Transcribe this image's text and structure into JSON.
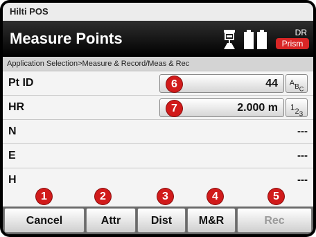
{
  "app": {
    "title": "Hilti POS"
  },
  "header": {
    "title": "Measure Points",
    "status_top": "DR",
    "status_badge": "Prism",
    "badge_color": "#d92626"
  },
  "breadcrumb": "Application Selection>Measure & Record/Meas & Rec",
  "fields": [
    {
      "label": "Pt ID",
      "value": "44",
      "mode_icon": "alpha-abc-icon"
    },
    {
      "label": "HR",
      "value": "2.000 m",
      "mode_icon": "numeric-123-icon"
    },
    {
      "label": "N",
      "value": "---"
    },
    {
      "label": "E",
      "value": "---"
    },
    {
      "label": "H",
      "value": "---"
    }
  ],
  "callouts": [
    "1",
    "2",
    "3",
    "4",
    "5",
    "6",
    "7"
  ],
  "softkeys": [
    {
      "label": "Cancel",
      "enabled": true
    },
    {
      "label": "Attr",
      "enabled": true
    },
    {
      "label": "Dist",
      "enabled": true
    },
    {
      "label": "M&R",
      "enabled": true
    },
    {
      "label": "Rec",
      "enabled": false
    }
  ],
  "colors": {
    "callout": "#d11b1b",
    "header_bg": "#000000"
  }
}
